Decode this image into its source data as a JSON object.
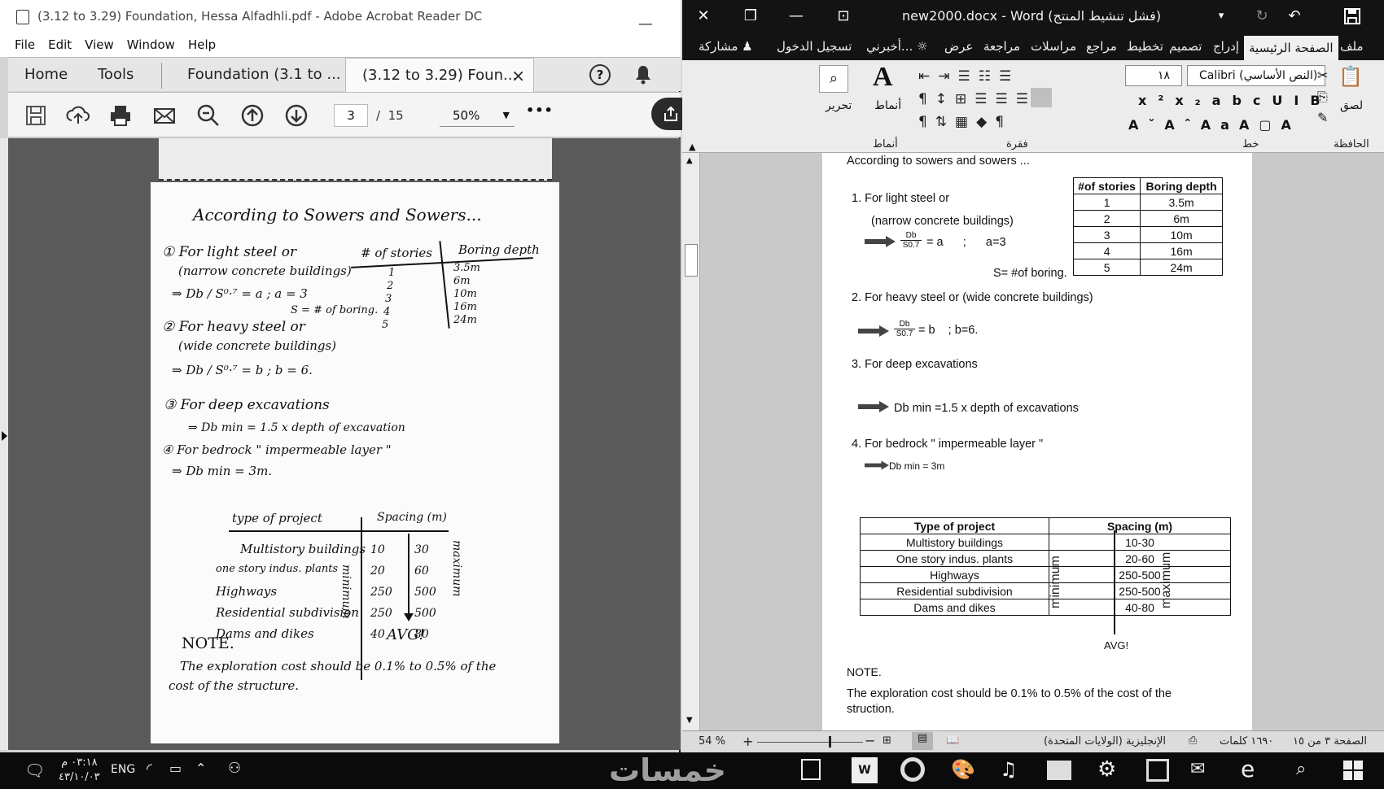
{
  "acrobat": {
    "window_title": "(3.12 to 3.29) Foundation, Hessa Alfadhli.pdf - Adobe Acrobat Reader DC",
    "menu": [
      "File",
      "Edit",
      "View",
      "Window",
      "Help"
    ],
    "nav": {
      "home": "Home",
      "tools": "Tools"
    },
    "tabs": [
      {
        "label": "Foundation (3.1 to ..."
      },
      {
        "label": "(3.12 to 3.29) Foun..."
      }
    ],
    "close_glyph": "×",
    "help_glyph": "?",
    "toolbar": {
      "page_current": "3",
      "page_sep": "/",
      "page_total": "15",
      "zoom": "50%",
      "more": "•••"
    }
  },
  "note_page": {
    "heading": "According to Sowers and Sowers...",
    "item1_a": "① For light steel or",
    "item1_b": "(narrow concrete buildings)",
    "item1_formula": "⇒ Db / S⁰·⁷ = a ; a = 3",
    "item1_s": "S = # of boring.",
    "table_headers": [
      "# of stories",
      "Boring depth"
    ],
    "table_rows": [
      [
        "1",
        "3.5m"
      ],
      [
        "2",
        "6m"
      ],
      [
        "3",
        "10m"
      ],
      [
        "4",
        "16m"
      ],
      [
        "5",
        "24m"
      ]
    ],
    "item2_a": "② For heavy steel or",
    "item2_b": "(wide concrete buildings)",
    "item2_formula": "⇒ Db / S⁰·⁷ = b ; b = 6.",
    "item3": "③ For deep excavations",
    "item3_formula": "⇒ Db min = 1.5 x depth of excavation",
    "item4": "④ For bedrock \" impermeable layer \"",
    "item4_formula": "⇒ Db min = 3m.",
    "spacing_headers": [
      "type of project",
      "Spacing (m)"
    ],
    "spacing_rows": [
      [
        "Multistory buildings",
        "10",
        "30"
      ],
      [
        "one story indus. plants",
        "20",
        "60"
      ],
      [
        "Highways",
        "250",
        "500"
      ],
      [
        "Residential subdivision",
        "250",
        "500"
      ],
      [
        "Dams and dikes",
        "40",
        "80"
      ]
    ],
    "minimum_label": "minimum",
    "maximum_label": "maximum",
    "avg": "AVG!",
    "note_title": "NOTE.",
    "note_text_1": "The exploration cost should be 0.1% to 0.5% of the",
    "note_text_2": "cost of the structure."
  },
  "word": {
    "window_title": "new2000.docx - Word (فشل تنشيط المنتج)",
    "ribbon_tabs": [
      "ملف",
      "الصفحة الرئيسية",
      "إدراج",
      "تصميم",
      "تخطيط",
      "مراجع",
      "مراسلات",
      "مراجعة",
      "عرض",
      "أخبرني..."
    ],
    "signin": "تسجيل الدخول",
    "share": "مشاركة",
    "font_name": "Calibri (النص الأساسي)",
    "font_size": "١٨",
    "groups": {
      "clipboard": "الحافظة",
      "font": "خط",
      "paragraph": "فقرة",
      "styles": "أنماط",
      "editing": "تحرير",
      "paste": "لصق",
      "styles_btn": "أنماط"
    },
    "doc": {
      "heading": "According to sowers and sowers ...",
      "item1_a": "1. For light steel or",
      "item1_b": "(narrow concrete buildings)",
      "item1_frac_num": "Db",
      "item1_frac_den": "S0.7",
      "item1_eq": "= a      ;      a=3",
      "item1_s": "S= #of boring.",
      "table_headers": [
        "#of stories",
        "Boring depth"
      ],
      "table_rows": [
        [
          "1",
          "3.5m"
        ],
        [
          "2",
          "6m"
        ],
        [
          "3",
          "10m"
        ],
        [
          "4",
          "16m"
        ],
        [
          "5",
          "24m"
        ]
      ],
      "item2": "2. For heavy steel or (wide concrete buildings)",
      "item2_frac_num": "Db",
      "item2_frac_den": "S0.7",
      "item2_eq": "= b    ; b=6.",
      "item3": "3. For deep excavations",
      "item3_formula": "Db min =1.5 x depth of excavations",
      "item4": "4. For bedrock \" impermeable layer \"",
      "item4_formula": "Db min = 3m",
      "spacing_headers": [
        "Type of project",
        "Spacing (m)"
      ],
      "spacing_rows": [
        [
          "Multistory buildings",
          "10-30"
        ],
        [
          "One story indus. plants",
          "20-60"
        ],
        [
          "Highways",
          "250-500"
        ],
        [
          "Residential subdivision",
          "250-500"
        ],
        [
          "Dams and dikes",
          "40-80"
        ]
      ],
      "minimum_label": "minimum",
      "maximum_label": "maximum",
      "avg": "AVG!",
      "note_title": "NOTE.",
      "note_text": "The exploration cost should be 0.1% to 0.5% of the cost of the struction."
    },
    "status": {
      "zoom": "54 %",
      "page": "الصفحة ٣ من ١٥",
      "words": "١٦٩٠ كلمات",
      "lang": "الإنجليزية (الولايات المتحدة)"
    }
  },
  "taskbar": {
    "time": "٠٣:١٨ م",
    "date": "٤٣/١٠/٠٣",
    "lang": "ENG",
    "watermark": "خمسات"
  }
}
